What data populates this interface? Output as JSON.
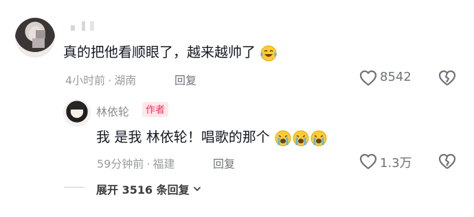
{
  "comment": {
    "text": "真的把他看顺眼了，越来越帅了",
    "time": "4小时前",
    "location": "湖南",
    "reply_label": "回复",
    "likes": "8542"
  },
  "reply": {
    "author": "林依轮",
    "badge": "作者",
    "text": "我 是我 林依轮！唱歌的那个",
    "time": "59分钟前",
    "location": "福建",
    "reply_label": "回复",
    "likes": "1.3万"
  },
  "expand": {
    "label": "展开 3516 条回复"
  },
  "icons": {
    "like": "heart-icon",
    "dislike": "broken-heart-icon",
    "emoji_laugh": "tears-of-joy-emoji",
    "emoji_cry": "loudly-crying-emoji",
    "expand": "chevron-down-icon"
  },
  "colors": {
    "badge": "#fe2c55",
    "meta": "#9a9ba1"
  }
}
